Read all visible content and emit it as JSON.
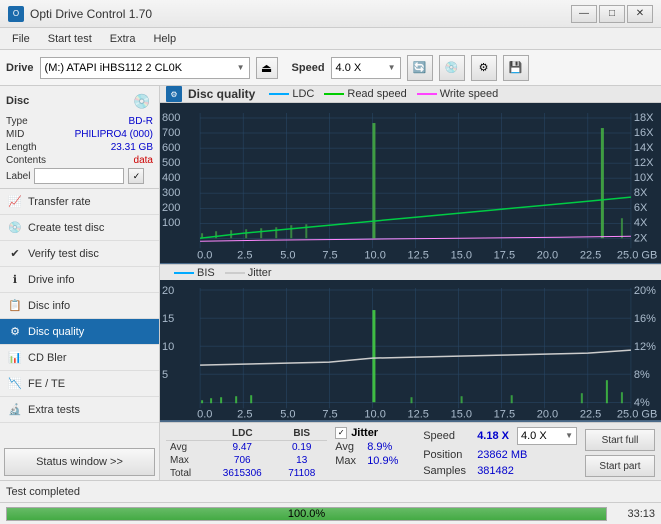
{
  "titlebar": {
    "title": "Opti Drive Control 1.70",
    "minimize": "—",
    "maximize": "□",
    "close": "✕"
  },
  "menubar": {
    "items": [
      "File",
      "Start test",
      "Extra",
      "Help"
    ]
  },
  "toolbar": {
    "drive_label": "Drive",
    "drive_value": "(M:) ATAPI iHBS112  2 CL0K",
    "speed_label": "Speed",
    "speed_value": "4.0 X"
  },
  "sidebar": {
    "disc_label": "Disc",
    "disc_type_label": "Type",
    "disc_type_value": "BD-R",
    "disc_mid_label": "MID",
    "disc_mid_value": "PHILIPRO4 (000)",
    "disc_length_label": "Length",
    "disc_length_value": "23.31 GB",
    "disc_contents_label": "Contents",
    "disc_contents_value": "data",
    "disc_label_label": "Label",
    "disc_label_input": "",
    "nav_items": [
      {
        "id": "transfer-rate",
        "label": "Transfer rate",
        "icon": "📈"
      },
      {
        "id": "create-test-disc",
        "label": "Create test disc",
        "icon": "💿"
      },
      {
        "id": "verify-test-disc",
        "label": "Verify test disc",
        "icon": "✔"
      },
      {
        "id": "drive-info",
        "label": "Drive info",
        "icon": "ℹ"
      },
      {
        "id": "disc-info",
        "label": "Disc info",
        "icon": "📋"
      },
      {
        "id": "disc-quality",
        "label": "Disc quality",
        "icon": "⚙",
        "active": true
      },
      {
        "id": "cd-bler",
        "label": "CD Bler",
        "icon": "📊"
      },
      {
        "id": "fe-te",
        "label": "FE / TE",
        "icon": "📉"
      },
      {
        "id": "extra-tests",
        "label": "Extra tests",
        "icon": "🔬"
      }
    ],
    "status_button": "Status window >>"
  },
  "content": {
    "title": "Disc quality",
    "legend_top": {
      "ldc": "LDC",
      "read": "Read speed",
      "write": "Write speed"
    },
    "legend_bottom": {
      "bis": "BIS",
      "jitter": "Jitter"
    },
    "chart_top": {
      "y_max": 800,
      "y_labels": [
        "800",
        "700",
        "600",
        "500",
        "400",
        "300",
        "200",
        "100"
      ],
      "y_right": [
        "18X",
        "16X",
        "14X",
        "12X",
        "10X",
        "8X",
        "6X",
        "4X",
        "2X"
      ],
      "x_labels": [
        "0.0",
        "2.5",
        "5.0",
        "7.5",
        "10.0",
        "12.5",
        "15.0",
        "17.5",
        "20.0",
        "22.5",
        "25.0 GB"
      ]
    },
    "chart_bottom": {
      "y_max": 20,
      "y_labels": [
        "20",
        "15",
        "10",
        "5"
      ],
      "y_right": [
        "20%",
        "16%",
        "12%",
        "8%",
        "4%"
      ],
      "x_labels": [
        "0.0",
        "2.5",
        "5.0",
        "7.5",
        "10.0",
        "12.5",
        "15.0",
        "17.5",
        "20.0",
        "22.5",
        "25.0 GB"
      ]
    }
  },
  "data_panel": {
    "col_headers": [
      "LDC",
      "BIS"
    ],
    "rows": [
      {
        "label": "Avg",
        "ldc": "9.47",
        "bis": "0.19"
      },
      {
        "label": "Max",
        "ldc": "706",
        "bis": "13"
      },
      {
        "label": "Total",
        "ldc": "3615306",
        "bis": "71108"
      }
    ],
    "jitter_label": "Jitter",
    "jitter_checked": true,
    "jitter_avg": "8.9%",
    "jitter_max": "10.9%",
    "speed_label": "Speed",
    "speed_value": "4.18 X",
    "speed_select": "4.0 X",
    "position_label": "Position",
    "position_value": "23862 MB",
    "samples_label": "Samples",
    "samples_value": "381482",
    "btn_start_full": "Start full",
    "btn_start_part": "Start part"
  },
  "statusbar": {
    "status_text": "Test completed"
  },
  "progressbar": {
    "percent": 100,
    "percent_text": "100.0%",
    "time": "33:13"
  }
}
